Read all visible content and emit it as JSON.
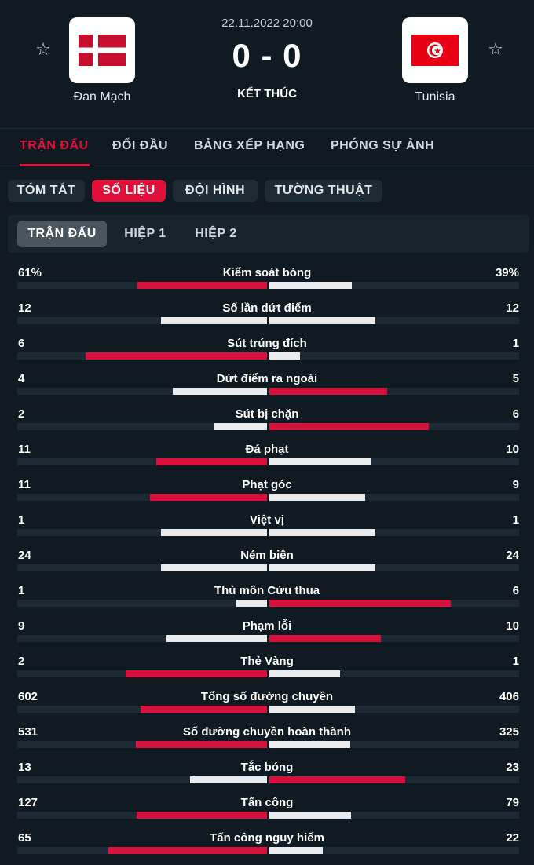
{
  "match": {
    "datetime": "22.11.2022 20:00",
    "score": "0 - 0",
    "status": "KẾT THÚC",
    "home": {
      "name": "Đan Mạch",
      "flag": "denmark-flag"
    },
    "away": {
      "name": "Tunisia",
      "flag": "tunisia-flag"
    },
    "favorite_icon": "☆"
  },
  "main_tabs": [
    {
      "label": "TRẬN ĐẤU",
      "active": true
    },
    {
      "label": "ĐỐI ĐẦU",
      "active": false
    },
    {
      "label": "BẢNG XẾP HẠNG",
      "active": false
    },
    {
      "label": "PHÓNG SỰ ẢNH",
      "active": false
    }
  ],
  "sub_tabs": [
    {
      "label": "TÓM TẮT",
      "active": false
    },
    {
      "label": "SỐ LIỆU",
      "active": true
    },
    {
      "label": "ĐỘI HÌNH",
      "active": false
    },
    {
      "label": "TƯỜNG THUẬT",
      "active": false
    }
  ],
  "periods": [
    {
      "label": "TRẬN ĐẤU",
      "active": true
    },
    {
      "label": "HIỆP 1",
      "active": false
    },
    {
      "label": "HIỆP 2",
      "active": false
    }
  ],
  "colors": {
    "accent": "#e1103b",
    "background": "#0f1a22",
    "bar_leader": "#d7103c",
    "bar_other": "#e9ecef"
  },
  "stats": [
    {
      "label": "Kiểm soát bóng",
      "home": "61%",
      "away": "39%",
      "home_value": 61,
      "away_value": 39
    },
    {
      "label": "Số lần dứt điểm",
      "home": "12",
      "away": "12",
      "home_value": 12,
      "away_value": 12
    },
    {
      "label": "Sút trúng đích",
      "home": "6",
      "away": "1",
      "home_value": 6,
      "away_value": 1
    },
    {
      "label": "Dứt điểm ra ngoài",
      "home": "4",
      "away": "5",
      "home_value": 4,
      "away_value": 5
    },
    {
      "label": "Sút bị chặn",
      "home": "2",
      "away": "6",
      "home_value": 2,
      "away_value": 6
    },
    {
      "label": "Đá phạt",
      "home": "11",
      "away": "10",
      "home_value": 11,
      "away_value": 10
    },
    {
      "label": "Phạt góc",
      "home": "11",
      "away": "9",
      "home_value": 11,
      "away_value": 9
    },
    {
      "label": "Việt vị",
      "home": "1",
      "away": "1",
      "home_value": 1,
      "away_value": 1
    },
    {
      "label": "Ném biên",
      "home": "24",
      "away": "24",
      "home_value": 24,
      "away_value": 24
    },
    {
      "label": "Thủ môn Cứu thua",
      "home": "1",
      "away": "6",
      "home_value": 1,
      "away_value": 6
    },
    {
      "label": "Phạm lỗi",
      "home": "9",
      "away": "10",
      "home_value": 9,
      "away_value": 10
    },
    {
      "label": "Thẻ Vàng",
      "home": "2",
      "away": "1",
      "home_value": 2,
      "away_value": 1
    },
    {
      "label": "Tổng số đường chuyền",
      "home": "602",
      "away": "406",
      "home_value": 602,
      "away_value": 406
    },
    {
      "label": "Số đường chuyền hoàn thành",
      "home": "531",
      "away": "325",
      "home_value": 531,
      "away_value": 325
    },
    {
      "label": "Tắc bóng",
      "home": "13",
      "away": "23",
      "home_value": 13,
      "away_value": 23
    },
    {
      "label": "Tấn công",
      "home": "127",
      "away": "79",
      "home_value": 127,
      "away_value": 79
    },
    {
      "label": "Tấn công nguy hiểm",
      "home": "65",
      "away": "22",
      "home_value": 65,
      "away_value": 22
    }
  ]
}
